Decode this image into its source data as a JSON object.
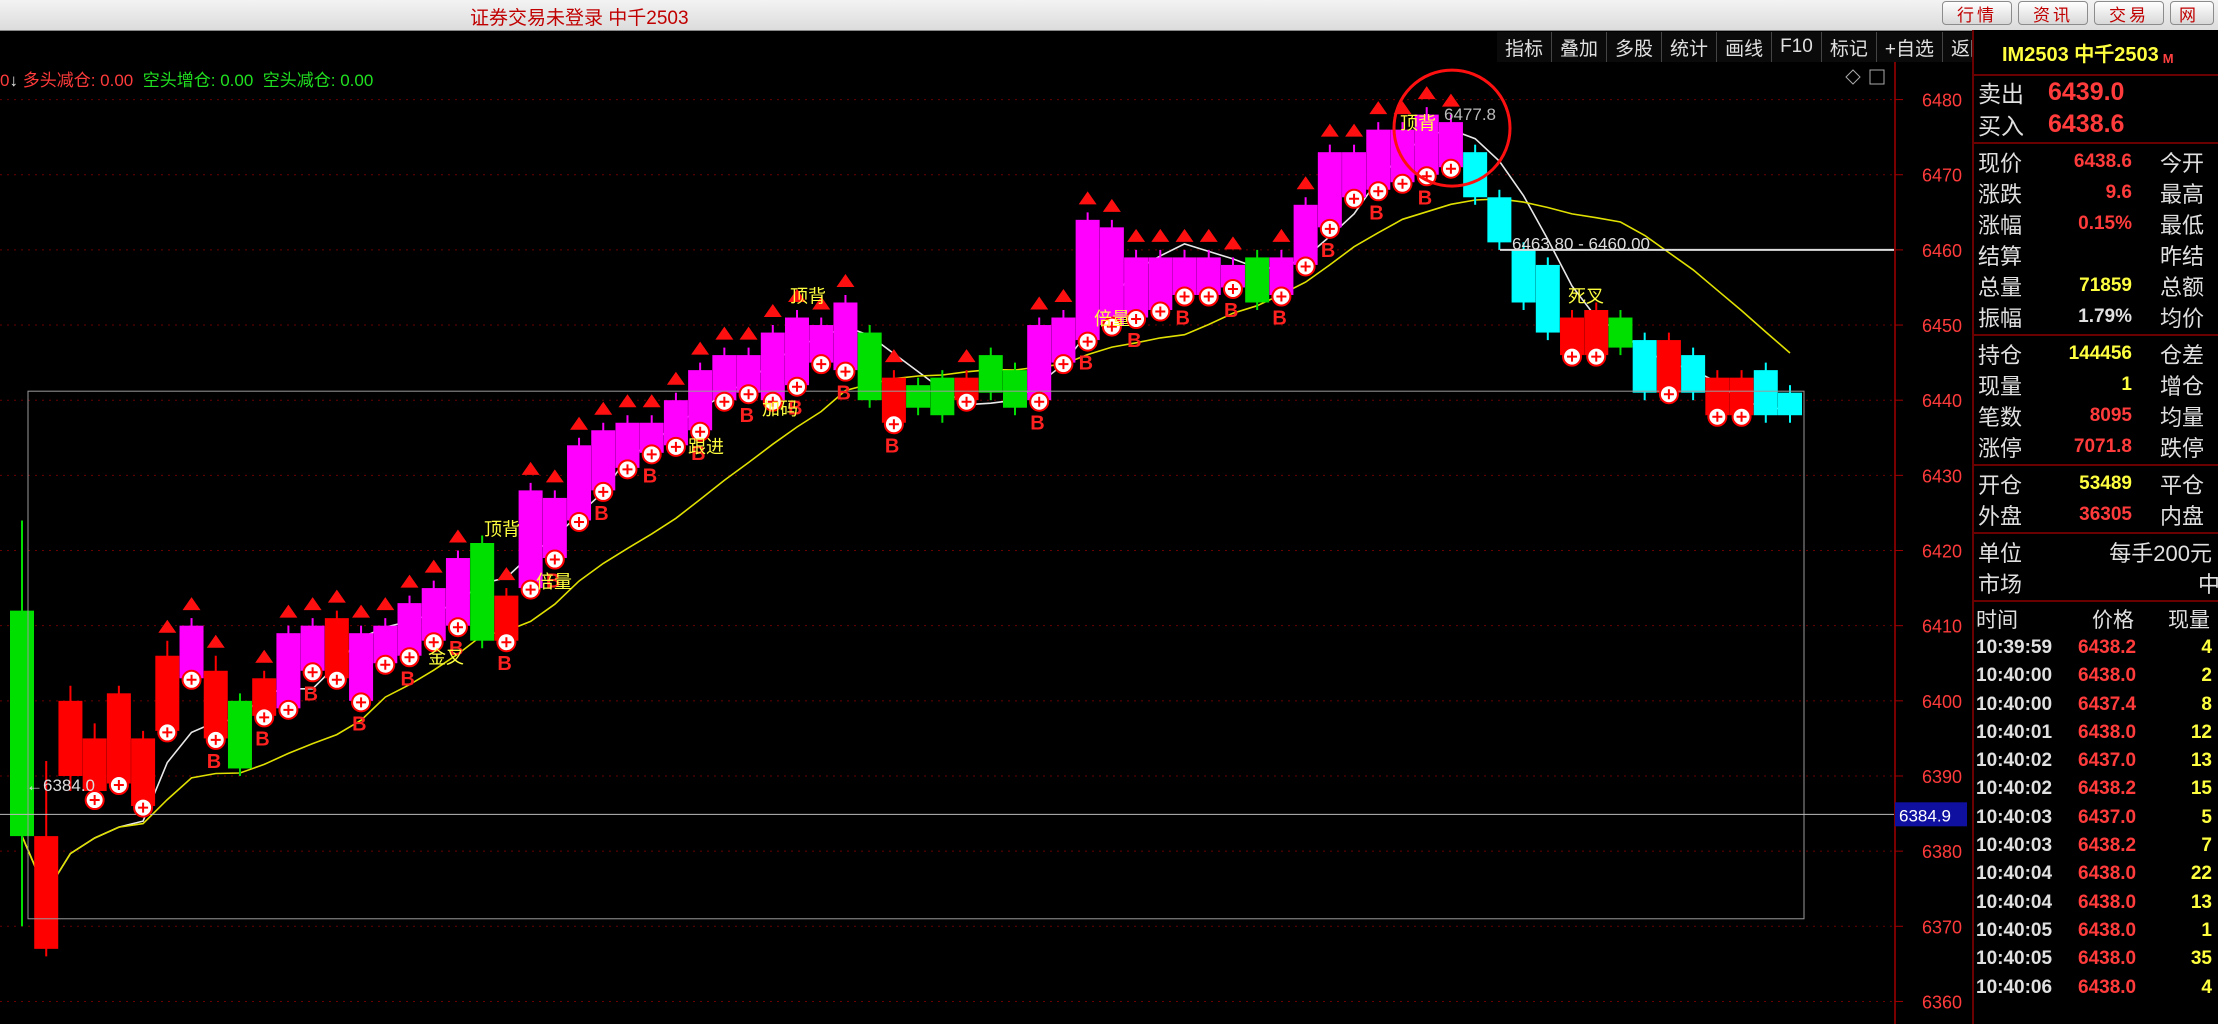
{
  "window": {
    "title": "证券交易未登录  中千2503"
  },
  "top_nav": [
    "行情",
    "资讯",
    "交易",
    "网"
  ],
  "toolbar": [
    "指标",
    "叠加",
    "多股",
    "统计",
    "画线",
    "F10",
    "标记",
    "+自选",
    "返回"
  ],
  "indicator_line": {
    "prefix": "0",
    "long_reduce_label": "多头减仓:",
    "long_reduce_value": "0.00",
    "short_add_label": "空头增仓:",
    "short_add_value": "0.00",
    "short_reduce_label": "空头减仓:",
    "short_reduce_value": "0.00"
  },
  "chart_data": {
    "type": "candlestick",
    "y_ticks": [
      6480,
      6470,
      6460,
      6450,
      6440,
      6430,
      6420,
      6410,
      6400,
      6390,
      6380,
      6370,
      6360
    ],
    "ylim": [
      6357,
      6485
    ],
    "current_price_tag": "6384.9",
    "range_label": "6463.80 - 6460.00",
    "peak_label": "6477.8",
    "low_label": "←6384.0",
    "annotations": [
      "顶背",
      "加码",
      "倍量",
      "跟进",
      "金叉",
      "死叉"
    ],
    "bar_colors": {
      "up_magenta": "#ff00ff",
      "up_red": "#ff0000",
      "down_green": "#00e000",
      "down_cyan": "#00ffff",
      "ma_white": "#e8e8e8",
      "ma_yellow": "#e0e000"
    },
    "candles": [
      {
        "o": 6412,
        "c": 6382,
        "h": 6424,
        "l": 6370,
        "col": "down_green"
      },
      {
        "o": 6382,
        "c": 6367,
        "h": 6392,
        "l": 6366,
        "col": "up_red"
      },
      {
        "o": 6400,
        "c": 6390,
        "h": 6402,
        "l": 6388,
        "col": "up_red"
      },
      {
        "o": 6395,
        "c": 6388,
        "h": 6397,
        "l": 6386,
        "col": "up_red"
      },
      {
        "o": 6401,
        "c": 6389,
        "h": 6402,
        "l": 6388,
        "col": "up_red"
      },
      {
        "o": 6395,
        "c": 6386,
        "h": 6396,
        "l": 6385,
        "col": "up_red"
      },
      {
        "o": 6396,
        "c": 6406,
        "h": 6408,
        "l": 6395,
        "col": "up_red"
      },
      {
        "o": 6403,
        "c": 6410,
        "h": 6411,
        "l": 6402,
        "col": "up_magenta"
      },
      {
        "o": 6404,
        "c": 6395,
        "h": 6406,
        "l": 6394,
        "col": "up_red"
      },
      {
        "o": 6400,
        "c": 6391,
        "h": 6401,
        "l": 6390,
        "col": "down_green"
      },
      {
        "o": 6398,
        "c": 6403,
        "h": 6404,
        "l": 6397,
        "col": "up_red"
      },
      {
        "o": 6399,
        "c": 6409,
        "h": 6410,
        "l": 6398,
        "col": "up_magenta"
      },
      {
        "o": 6404,
        "c": 6410,
        "h": 6411,
        "l": 6403,
        "col": "up_magenta"
      },
      {
        "o": 6403,
        "c": 6411,
        "h": 6412,
        "l": 6402,
        "col": "up_red"
      },
      {
        "o": 6400,
        "c": 6409,
        "h": 6410,
        "l": 6399,
        "col": "up_magenta"
      },
      {
        "o": 6405,
        "c": 6410,
        "h": 6411,
        "l": 6404,
        "col": "up_magenta"
      },
      {
        "o": 6406,
        "c": 6413,
        "h": 6414,
        "l": 6405,
        "col": "up_magenta"
      },
      {
        "o": 6408,
        "c": 6415,
        "h": 6416,
        "l": 6407,
        "col": "up_magenta"
      },
      {
        "o": 6410,
        "c": 6419,
        "h": 6420,
        "l": 6409,
        "col": "up_magenta"
      },
      {
        "o": 6408,
        "c": 6421,
        "h": 6422,
        "l": 6407,
        "col": "down_green"
      },
      {
        "o": 6408,
        "c": 6414,
        "h": 6415,
        "l": 6407,
        "col": "up_red"
      },
      {
        "o": 6415,
        "c": 6428,
        "h": 6429,
        "l": 6414,
        "col": "up_magenta"
      },
      {
        "o": 6419,
        "c": 6427,
        "h": 6428,
        "l": 6418,
        "col": "up_magenta"
      },
      {
        "o": 6424,
        "c": 6434,
        "h": 6435,
        "l": 6423,
        "col": "up_magenta"
      },
      {
        "o": 6428,
        "c": 6436,
        "h": 6437,
        "l": 6427,
        "col": "up_magenta"
      },
      {
        "o": 6431,
        "c": 6437,
        "h": 6438,
        "l": 6430,
        "col": "up_magenta"
      },
      {
        "o": 6433,
        "c": 6437,
        "h": 6438,
        "l": 6432,
        "col": "up_magenta"
      },
      {
        "o": 6434,
        "c": 6440,
        "h": 6441,
        "l": 6433,
        "col": "up_magenta"
      },
      {
        "o": 6436,
        "c": 6444,
        "h": 6445,
        "l": 6435,
        "col": "up_magenta"
      },
      {
        "o": 6440,
        "c": 6446,
        "h": 6447,
        "l": 6439,
        "col": "up_magenta"
      },
      {
        "o": 6441,
        "c": 6446,
        "h": 6447,
        "l": 6440,
        "col": "up_magenta"
      },
      {
        "o": 6440,
        "c": 6449,
        "h": 6450,
        "l": 6439,
        "col": "up_magenta"
      },
      {
        "o": 6442,
        "c": 6451,
        "h": 6452,
        "l": 6441,
        "col": "up_magenta"
      },
      {
        "o": 6445,
        "c": 6450,
        "h": 6451,
        "l": 6444,
        "col": "up_magenta"
      },
      {
        "o": 6444,
        "c": 6453,
        "h": 6454,
        "l": 6443,
        "col": "up_magenta"
      },
      {
        "o": 6449,
        "c": 6440,
        "h": 6450,
        "l": 6439,
        "col": "down_green"
      },
      {
        "o": 6443,
        "c": 6437,
        "h": 6444,
        "l": 6436,
        "col": "up_red"
      },
      {
        "o": 6442,
        "c": 6439,
        "h": 6443,
        "l": 6438,
        "col": "down_green"
      },
      {
        "o": 6443,
        "c": 6438,
        "h": 6444,
        "l": 6437,
        "col": "down_green"
      },
      {
        "o": 6440,
        "c": 6443,
        "h": 6444,
        "l": 6439,
        "col": "up_red"
      },
      {
        "o": 6446,
        "c": 6441,
        "h": 6447,
        "l": 6440,
        "col": "down_green"
      },
      {
        "o": 6444,
        "c": 6439,
        "h": 6445,
        "l": 6438,
        "col": "down_green"
      },
      {
        "o": 6440,
        "c": 6450,
        "h": 6451,
        "l": 6439,
        "col": "up_magenta"
      },
      {
        "o": 6445,
        "c": 6451,
        "h": 6452,
        "l": 6444,
        "col": "up_magenta"
      },
      {
        "o": 6448,
        "c": 6464,
        "h": 6465,
        "l": 6447,
        "col": "up_magenta"
      },
      {
        "o": 6450,
        "c": 6463,
        "h": 6464,
        "l": 6449,
        "col": "up_magenta"
      },
      {
        "o": 6451,
        "c": 6459,
        "h": 6460,
        "l": 6450,
        "col": "up_magenta"
      },
      {
        "o": 6452,
        "c": 6459,
        "h": 6460,
        "l": 6451,
        "col": "up_magenta"
      },
      {
        "o": 6454,
        "c": 6459,
        "h": 6460,
        "l": 6453,
        "col": "up_magenta"
      },
      {
        "o": 6454,
        "c": 6459,
        "h": 6460,
        "l": 6453,
        "col": "up_magenta"
      },
      {
        "o": 6455,
        "c": 6458,
        "h": 6459,
        "l": 6454,
        "col": "up_magenta"
      },
      {
        "o": 6459,
        "c": 6453,
        "h": 6460,
        "l": 6452,
        "col": "down_green"
      },
      {
        "o": 6454,
        "c": 6459,
        "h": 6460,
        "l": 6453,
        "col": "up_magenta"
      },
      {
        "o": 6458,
        "c": 6466,
        "h": 6467,
        "l": 6457,
        "col": "up_magenta"
      },
      {
        "o": 6463,
        "c": 6473,
        "h": 6474,
        "l": 6462,
        "col": "up_magenta"
      },
      {
        "o": 6467,
        "c": 6473,
        "h": 6474,
        "l": 6466,
        "col": "up_magenta"
      },
      {
        "o": 6468,
        "c": 6476,
        "h": 6477,
        "l": 6467,
        "col": "up_magenta"
      },
      {
        "o": 6469,
        "c": 6476,
        "h": 6477,
        "l": 6468,
        "col": "up_magenta"
      },
      {
        "o": 6470,
        "c": 6478,
        "h": 6479,
        "l": 6469,
        "col": "up_magenta"
      },
      {
        "o": 6471,
        "c": 6477,
        "h": 6478,
        "l": 6470,
        "col": "up_magenta"
      },
      {
        "o": 6473,
        "c": 6467,
        "h": 6474,
        "l": 6466,
        "col": "down_cyan"
      },
      {
        "o": 6467,
        "c": 6461,
        "h": 6468,
        "l": 6460,
        "col": "down_cyan"
      },
      {
        "o": 6460,
        "c": 6453,
        "h": 6461,
        "l": 6452,
        "col": "down_cyan"
      },
      {
        "o": 6458,
        "c": 6449,
        "h": 6459,
        "l": 6448,
        "col": "down_cyan"
      },
      {
        "o": 6451,
        "c": 6446,
        "h": 6452,
        "l": 6445,
        "col": "up_red"
      },
      {
        "o": 6452,
        "c": 6446,
        "h": 6453,
        "l": 6445,
        "col": "up_red"
      },
      {
        "o": 6447,
        "c": 6451,
        "h": 6452,
        "l": 6446,
        "col": "down_green"
      },
      {
        "o": 6448,
        "c": 6441,
        "h": 6449,
        "l": 6440,
        "col": "down_cyan"
      },
      {
        "o": 6448,
        "c": 6441,
        "h": 6449,
        "l": 6440,
        "col": "up_red"
      },
      {
        "o": 6446,
        "c": 6441,
        "h": 6447,
        "l": 6440,
        "col": "down_cyan"
      },
      {
        "o": 6443,
        "c": 6438,
        "h": 6444,
        "l": 6437,
        "col": "up_red"
      },
      {
        "o": 6443,
        "c": 6438,
        "h": 6444,
        "l": 6437,
        "col": "up_red"
      },
      {
        "o": 6444,
        "c": 6438,
        "h": 6445,
        "l": 6437,
        "col": "down_cyan"
      },
      {
        "o": 6441,
        "c": 6438,
        "h": 6442,
        "l": 6437,
        "col": "down_cyan"
      }
    ]
  },
  "panel": {
    "contract": "IM2503 中千2503",
    "contract_suffix": "M",
    "sell_label": "卖出",
    "sell_price": "6439.0",
    "buy_label": "买入",
    "buy_price": "6438.6",
    "quote": [
      {
        "l": "现价",
        "v": "6438.6",
        "c": "cred",
        "r": "今开"
      },
      {
        "l": "涨跌",
        "v": "9.6",
        "c": "cred",
        "r": "最高"
      },
      {
        "l": "涨幅",
        "v": "0.15%",
        "c": "cred",
        "r": "最低"
      },
      {
        "l": "结算",
        "v": "",
        "c": "cred",
        "r": "昨结"
      },
      {
        "l": "总量",
        "v": "71859",
        "c": "cyel",
        "r": "总额"
      },
      {
        "l": "振幅",
        "v": "1.79%",
        "c": "cwhite",
        "r": "均价"
      }
    ],
    "quote2": [
      {
        "l": "持仓",
        "v": "144456",
        "c": "cyel",
        "r": "仓差"
      },
      {
        "l": "现量",
        "v": "1",
        "c": "cyel",
        "r": "增仓"
      },
      {
        "l": "笔数",
        "v": "8095",
        "c": "cred",
        "r": "均量"
      },
      {
        "l": "涨停",
        "v": "7071.8",
        "c": "cred",
        "r": "跌停"
      }
    ],
    "quote3": [
      {
        "l": "开仓",
        "v": "53489",
        "c": "cyel",
        "r": "平仓"
      },
      {
        "l": "外盘",
        "v": "36305",
        "c": "cred",
        "r": "内盘"
      }
    ],
    "unit_label": "单位",
    "unit_value": "每手200元",
    "market_label": "市场",
    "market_value": "中",
    "tick_headers": [
      "时间",
      "价格",
      "现量"
    ],
    "ticks": [
      [
        "10:39:59",
        "6438.2",
        "4"
      ],
      [
        "10:40:00",
        "6438.0",
        "2"
      ],
      [
        "10:40:00",
        "6437.4",
        "8"
      ],
      [
        "10:40:01",
        "6438.0",
        "12"
      ],
      [
        "10:40:02",
        "6437.0",
        "13"
      ],
      [
        "10:40:02",
        "6438.2",
        "15"
      ],
      [
        "10:40:03",
        "6437.0",
        "5"
      ],
      [
        "10:40:03",
        "6438.2",
        "7"
      ],
      [
        "10:40:04",
        "6438.0",
        "22"
      ],
      [
        "10:40:04",
        "6438.0",
        "13"
      ],
      [
        "10:40:05",
        "6438.0",
        "1"
      ],
      [
        "10:40:05",
        "6438.0",
        "35"
      ],
      [
        "10:40:06",
        "6438.0",
        "4"
      ]
    ]
  }
}
